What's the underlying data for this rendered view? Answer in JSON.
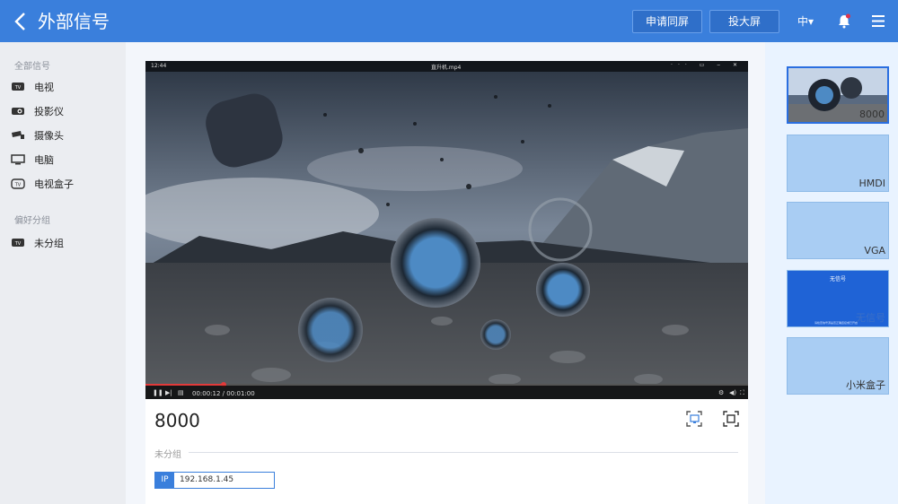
{
  "header": {
    "title": "外部信号",
    "btn_share": "申请同屏",
    "btn_project": "投大屏",
    "lang": "中▾"
  },
  "sidebar": {
    "all_title": "全部信号",
    "items": [
      {
        "label": "电视",
        "icon": "tv-icon"
      },
      {
        "label": "投影仪",
        "icon": "projector-icon"
      },
      {
        "label": "摄像头",
        "icon": "camera-icon"
      },
      {
        "label": "电脑",
        "icon": "monitor-icon"
      },
      {
        "label": "电视盒子",
        "icon": "tv-box-icon"
      }
    ],
    "fav_title": "偏好分组",
    "fav_items": [
      {
        "label": "未分组",
        "icon": "tv-icon"
      }
    ]
  },
  "video": {
    "clock": "12:44",
    "filename": "直升机.mp4",
    "time": "00:00:12 / 00:01:00",
    "progress": 0.13
  },
  "device": {
    "name": "8000",
    "group": "未分组",
    "ip_tag": "IP",
    "ip": "192.168.1.45"
  },
  "thumbs": [
    {
      "label": "8000",
      "active": true
    },
    {
      "label": "HMDI"
    },
    {
      "label": "VGA"
    },
    {
      "label": "无信号",
      "top": "无信号",
      "note": "请检查信号源是否正确连接或已开启"
    },
    {
      "label": "小米盒子"
    }
  ],
  "colors": {
    "accent": "#3a7fdc",
    "header": "#3a7fdc",
    "thumb": "#a9cdf3"
  }
}
